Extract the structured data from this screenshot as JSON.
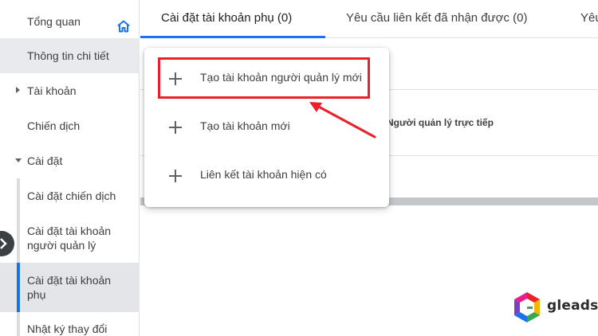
{
  "sidebar": {
    "items": [
      {
        "label": "Tổng quan"
      },
      {
        "label": "Thông tin chi tiết"
      },
      {
        "label": "Tài khoản"
      },
      {
        "label": "Chiến dịch"
      },
      {
        "label": "Cài đặt"
      },
      {
        "label": "Cài đặt chiến dịch"
      },
      {
        "label": "Cài đặt tài khoản người quản lý"
      },
      {
        "label": "Cài đặt tài khoản phụ"
      },
      {
        "label": "Nhật ký thay đổi"
      }
    ]
  },
  "tabs": [
    {
      "label": "Cài đặt tài khoản phụ (0)"
    },
    {
      "label": "Yêu cầu liên kết đã nhận được (0)"
    },
    {
      "label": "Yêu"
    }
  ],
  "table": {
    "column_header": "Người quản lý trực tiếp"
  },
  "menu": {
    "items": [
      {
        "label": "Tạo tài khoản người quản lý mới"
      },
      {
        "label": "Tạo tài khoản mới"
      },
      {
        "label": "Liên kết tài khoản hiện có"
      }
    ]
  },
  "logo": {
    "text": "gleads"
  },
  "colors": {
    "accent": "#1a73e8",
    "highlight": "#e8212b",
    "selected_bg": "#e3e5e8"
  }
}
